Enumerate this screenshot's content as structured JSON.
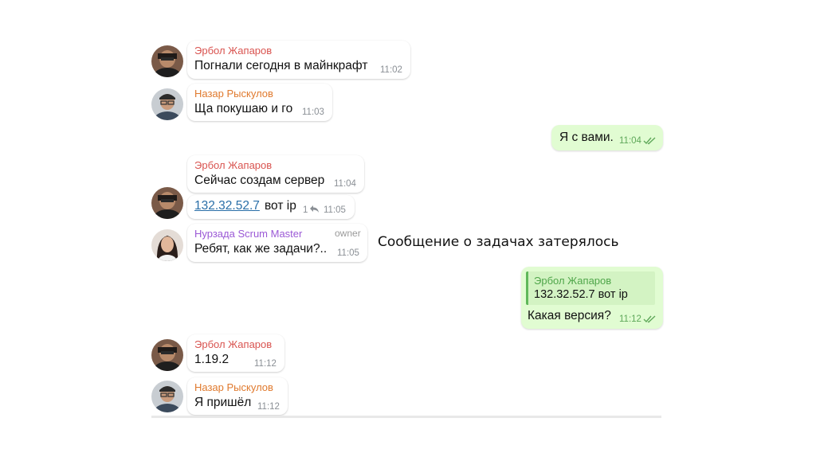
{
  "messages": {
    "m1": {
      "author": "Эрбол Жапаров",
      "text": "Погнали сегодня в майнкрафт",
      "time": "11:02"
    },
    "m2": {
      "author": "Назар Рыскулов",
      "text": "Ща покушаю и го",
      "time": "11:03"
    },
    "m3": {
      "text": "Я с вами.",
      "time": "11:04"
    },
    "m4": {
      "author": "Эрбол Жапаров",
      "text": "Сейчас создам сервер",
      "time": "11:04"
    },
    "m5": {
      "link": "132.32.52.7",
      "text": "вот ip",
      "reply_count": "1",
      "time": "11:05"
    },
    "m6": {
      "author": "Нурзада Scrum Master",
      "role": "owner",
      "text": "Ребят, как же задачи?..",
      "time": "11:05"
    },
    "m7": {
      "quote_author": "Эрбол Жапаров",
      "quote_text": "132.32.52.7 вот ip",
      "text": "Какая версия?",
      "time": "11:12"
    },
    "m8": {
      "author": "Эрбол Жапаров",
      "text": "1.19.2",
      "time": "11:12"
    },
    "m9": {
      "author": "Назар Рыскулов",
      "text": "Я пришёл",
      "time": "11:12"
    }
  },
  "caption": "Сообщение о задачах затерялось",
  "colors": {
    "erbol_name": "#d95450",
    "nazar_name": "#e07a2e",
    "nurzada_name": "#9b59d6",
    "outgoing_bubble": "#e1fcd2",
    "outgoing_time": "#5fa85a",
    "link": "#2a6fa8"
  },
  "icons": {
    "read": "double-check-icon",
    "reply": "reply-arrow-icon"
  }
}
